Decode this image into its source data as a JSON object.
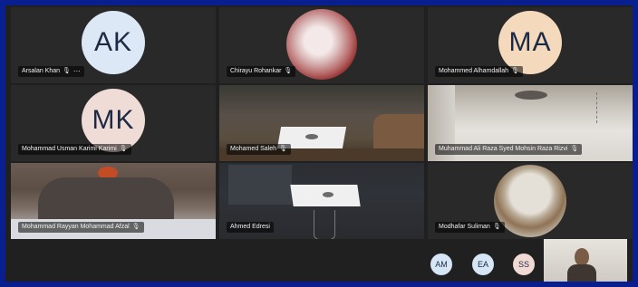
{
  "participants": [
    {
      "name": "Arsalan Khan",
      "initials": "AK",
      "avatar_color": "#dce8f5"
    },
    {
      "name": "Chirayu Rohankar",
      "avatar_icon": "virus-image"
    },
    {
      "name": "Mohammed Alhamdallah",
      "initials": "MA",
      "avatar_color": "#f4d9bd"
    },
    {
      "name": "Mohammad Usman Karimi Karimi",
      "initials": "MK",
      "avatar_color": "#efdcd6"
    },
    {
      "name": "Mohamed Saleh"
    },
    {
      "name": "Muhammad Ali Raza Syed Mohsin Raza Rizvi"
    },
    {
      "name": "Mohammad Rayyan Mohammad Afzal"
    },
    {
      "name": "Ahmed Edresi"
    },
    {
      "name": "Modhafar Suliman",
      "avatar_icon": "boat-image"
    }
  ],
  "overflow": [
    {
      "initials": "AM",
      "color": "#d6e6f5"
    },
    {
      "initials": "EA",
      "color": "#d6e6f5"
    },
    {
      "initials": "SS",
      "color": "#f1d9d4"
    }
  ],
  "icons": {
    "mic_muted": "mic-muted-icon",
    "more": "more-options-icon"
  }
}
